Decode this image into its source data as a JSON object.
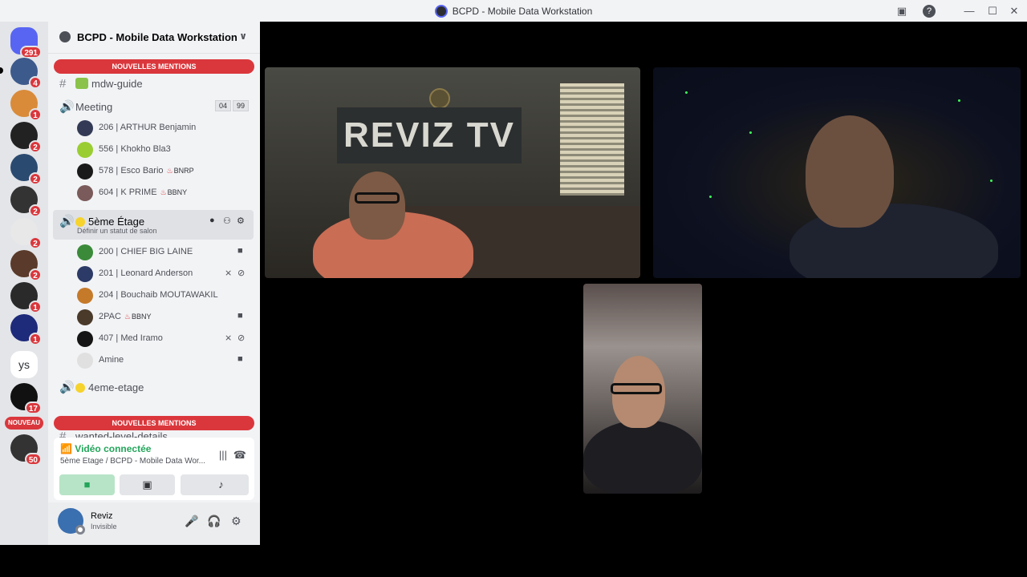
{
  "window": {
    "title": "BCPD - Mobile Data Workstation"
  },
  "rail": {
    "badges": [
      "291",
      "4",
      "1",
      "2",
      "2",
      "2",
      "2",
      "2",
      "1",
      "1",
      "17",
      "50"
    ],
    "text_item": "ys",
    "new_label": "NOUVEAU"
  },
  "server": {
    "name": "BCPD - Mobile Data Workstation"
  },
  "banners": {
    "top": "NOUVELLES MENTIONS",
    "bottom": "NOUVELLES MENTIONS"
  },
  "channels": {
    "guide": "mdw-guide",
    "meeting": {
      "name": "Meeting",
      "count": "04",
      "limit": "99"
    },
    "meeting_members": [
      {
        "name": "206 | ARTHUR Benjamin"
      },
      {
        "name": "556 | Khokho Bla3"
      },
      {
        "name": "578 | Esco Bario",
        "tag": "BNRP"
      },
      {
        "name": "604 | K PRIME",
        "tag": "BBNY"
      }
    ],
    "stage": {
      "name": "5ème Étage",
      "status": "Définir un statut de salon"
    },
    "stage_members": [
      {
        "name": "200 | CHIEF BIG LAINE"
      },
      {
        "name": "201 | Leonard Anderson"
      },
      {
        "name": "204 | Bouchaib MOUTAWAKIL"
      },
      {
        "name": "2PAC",
        "tag": "BBNY"
      },
      {
        "name": "407 | Med Iramo"
      },
      {
        "name": "Amine"
      }
    ],
    "fourth": "4eme-etage",
    "partial": "wanted-level-details"
  },
  "voice": {
    "title": "Vidéo connectée",
    "location": "5ème Étage / BCPD - Mobile Data Wor..."
  },
  "user": {
    "name": "Reviz",
    "status": "Invisible"
  },
  "video": {
    "wall_sign": "REVIZ TV"
  },
  "colors": {
    "danger": "#da373c",
    "online": "#23a55a",
    "sidebar": "#f2f3f5",
    "stage_bg": "#000000"
  }
}
